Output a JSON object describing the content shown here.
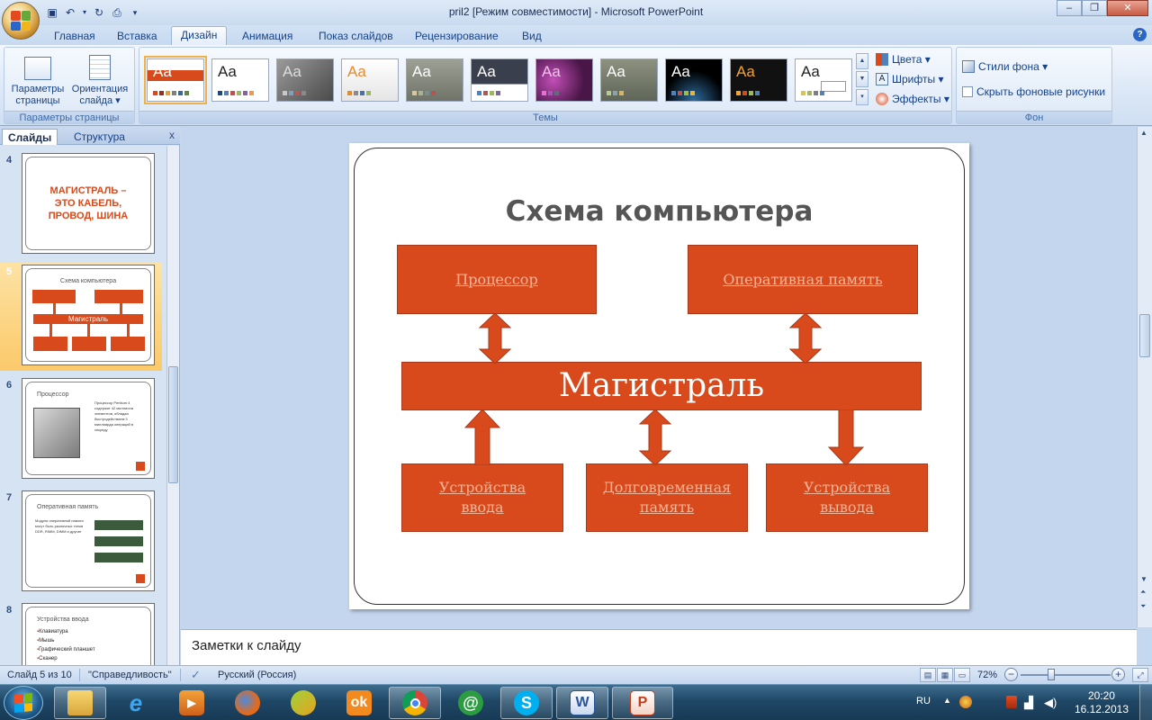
{
  "window": {
    "title": "pril2 [Режим совместимости] - Microsoft PowerPoint",
    "minimize": "–",
    "restore": "❐",
    "close": "✕"
  },
  "ribbon_tabs": [
    "Главная",
    "Вставка",
    "Дизайн",
    "Анимация",
    "Показ слайдов",
    "Рецензирование",
    "Вид"
  ],
  "active_tab": "Дизайн",
  "ribbon": {
    "page_setup": {
      "page_params_label": "Параметры страницы",
      "orientation_label": "Ориентация слайда ▾",
      "group_label": "Параметры страницы"
    },
    "themes": {
      "group_label": "Темы",
      "sample": "Aa",
      "colors_label": "Цвета ▾",
      "fonts_label": "Шрифты ▾",
      "effects_label": "Эффекты ▾"
    },
    "background": {
      "styles_label": "Стили фона ▾",
      "hide_bg_label": "Скрыть фоновые рисунки",
      "group_label": "Фон"
    }
  },
  "left_pane": {
    "tab_slides": "Слайды",
    "tab_outline": "Структура",
    "close": "x",
    "thumbs": [
      {
        "num": "4",
        "text": "МАГИСТРАЛЬ – ЭТО КАБЕЛЬ, ПРОВОД, ШИНА"
      },
      {
        "num": "5",
        "title": "Схема компьютера",
        "bus": "Магистраль"
      },
      {
        "num": "6",
        "title": "Процессор",
        "body": "Процессор Pentium 4 содержит 42 миллиона элементов, обладая быстродействием 3 миллиарда операций в секунду"
      },
      {
        "num": "7",
        "title": "Оперативная память",
        "body": "Модули оперативной памяти могут быть различных типов DDR, RIMM, DIMM и другие"
      },
      {
        "num": "8",
        "title": "Устройства ввода",
        "items": [
          "Клавиатура",
          "Мышь",
          "Графический планшет",
          "Сканер"
        ]
      }
    ]
  },
  "slide": {
    "title": "Схема компьютера",
    "processor": "Процессор",
    "ram": "Оперативная память",
    "bus": "Магистраль",
    "input_l1": "Устройства",
    "input_l2": "ввода",
    "storage_l1": "Долговременная",
    "storage_l2": "память",
    "output_l1": "Устройства",
    "output_l2": "вывода"
  },
  "notes": {
    "placeholder": "Заметки к слайду"
  },
  "status": {
    "slide_info": "Слайд 5 из 10",
    "theme": "\"Справедливость\"",
    "language": "Русский (Россия)",
    "zoom": "72%"
  },
  "taskbar": {
    "lang": "RU",
    "time": "20:20",
    "date": "16.12.2013"
  },
  "colors": {
    "accent": "#d84a1b",
    "box_text": "#f3b59a",
    "ribbon_text": "#15428b"
  }
}
